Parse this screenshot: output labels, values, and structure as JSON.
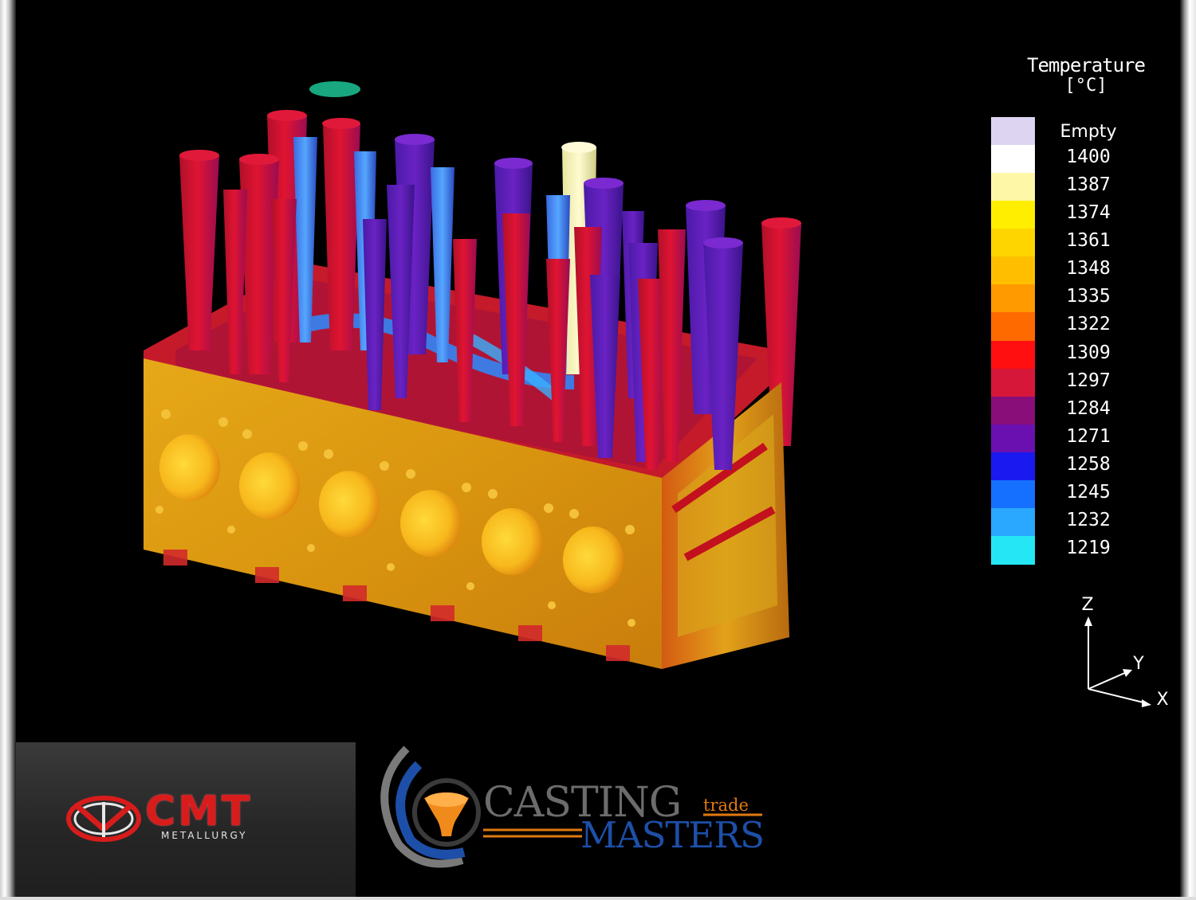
{
  "legend": {
    "title": "Temperature",
    "unit": "[°C]",
    "empty_label": "Empty",
    "values": [
      "1400",
      "1387",
      "1374",
      "1361",
      "1348",
      "1335",
      "1322",
      "1309",
      "1297",
      "1284",
      "1271",
      "1258",
      "1245",
      "1232",
      "1219"
    ],
    "colors": [
      "#dcd4f0",
      "#ffffff",
      "#fff7a8",
      "#ffee00",
      "#ffd500",
      "#ffbf00",
      "#ff9a00",
      "#ff6a00",
      "#ff0f0f",
      "#d6173a",
      "#8a0e7a",
      "#6a10b0",
      "#1a1af0",
      "#1570ff",
      "#2aa8ff",
      "#25e6f5"
    ]
  },
  "axes": {
    "z": "Z",
    "y": "Y",
    "x": "X"
  },
  "logos": {
    "cmt_word": "CMT",
    "cmt_sub": "METALLURGY",
    "cm_casting": "CASTING",
    "cm_trade": "trade",
    "cm_masters": "MASTERS"
  }
}
